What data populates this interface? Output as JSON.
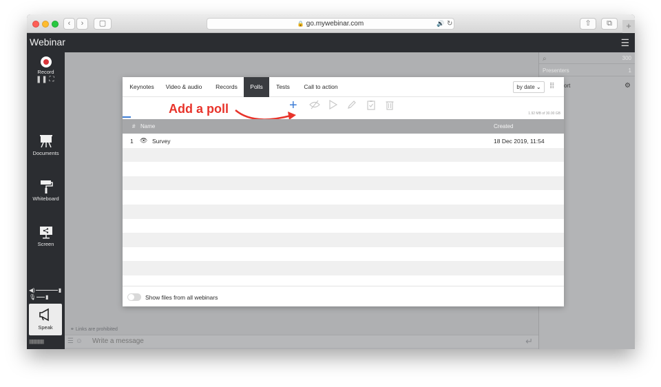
{
  "browser": {
    "url": "go.mywebinar.com",
    "nav_back": "‹",
    "nav_forward": "›",
    "sidebar_btn": "▢",
    "share_btn": "⇧",
    "tabs_btn": "⧉",
    "new_tab": "+",
    "icons": [
      "lock-icon",
      "audio-icon",
      "reload-icon"
    ]
  },
  "app": {
    "brand": "Webinar",
    "menu_icon": "☰"
  },
  "sidebar": {
    "record_label": "Record",
    "controls": "❚❚  ⛶",
    "items": [
      {
        "label": "Documents",
        "icon": "easel-icon",
        "glyph": "⛺"
      },
      {
        "label": "Whiteboard",
        "icon": "paint-roller-icon",
        "glyph": "🖌"
      },
      {
        "label": "Screen",
        "icon": "screen-share-icon",
        "glyph": "🖥"
      }
    ],
    "speak_label": "Speak"
  },
  "main": {
    "links_note": "Links are prohibited",
    "message_placeholder": "Write a message"
  },
  "right_panel": {
    "search_count": "300",
    "presenters_label": "Presenters",
    "presenters_count": "1",
    "support_label": "ort"
  },
  "dialog": {
    "tabs": [
      "Keynotes",
      "Video & audio",
      "Records",
      "Polls",
      "Tests",
      "Call to action"
    ],
    "active_tab": "Polls",
    "sort_label": "by date",
    "storage": "1.92 MB of 30.00 GB",
    "annotation": "Add a poll",
    "toolbar_icons": [
      "add-icon",
      "hide-icon",
      "play-icon",
      "edit-icon",
      "clipboard-icon",
      "trash-icon"
    ],
    "columns": {
      "num": "#",
      "name": "Name",
      "created": "Created"
    },
    "rows": [
      {
        "num": "1",
        "name": "Survey",
        "created": "18 Dec 2019, 11:54"
      }
    ],
    "show_files_label": "Show files from all webinars"
  },
  "colors": {
    "accent": "#3a7bd5",
    "annotation": "#e8332a",
    "dark": "#2b2d31",
    "record": "#d9343a"
  }
}
